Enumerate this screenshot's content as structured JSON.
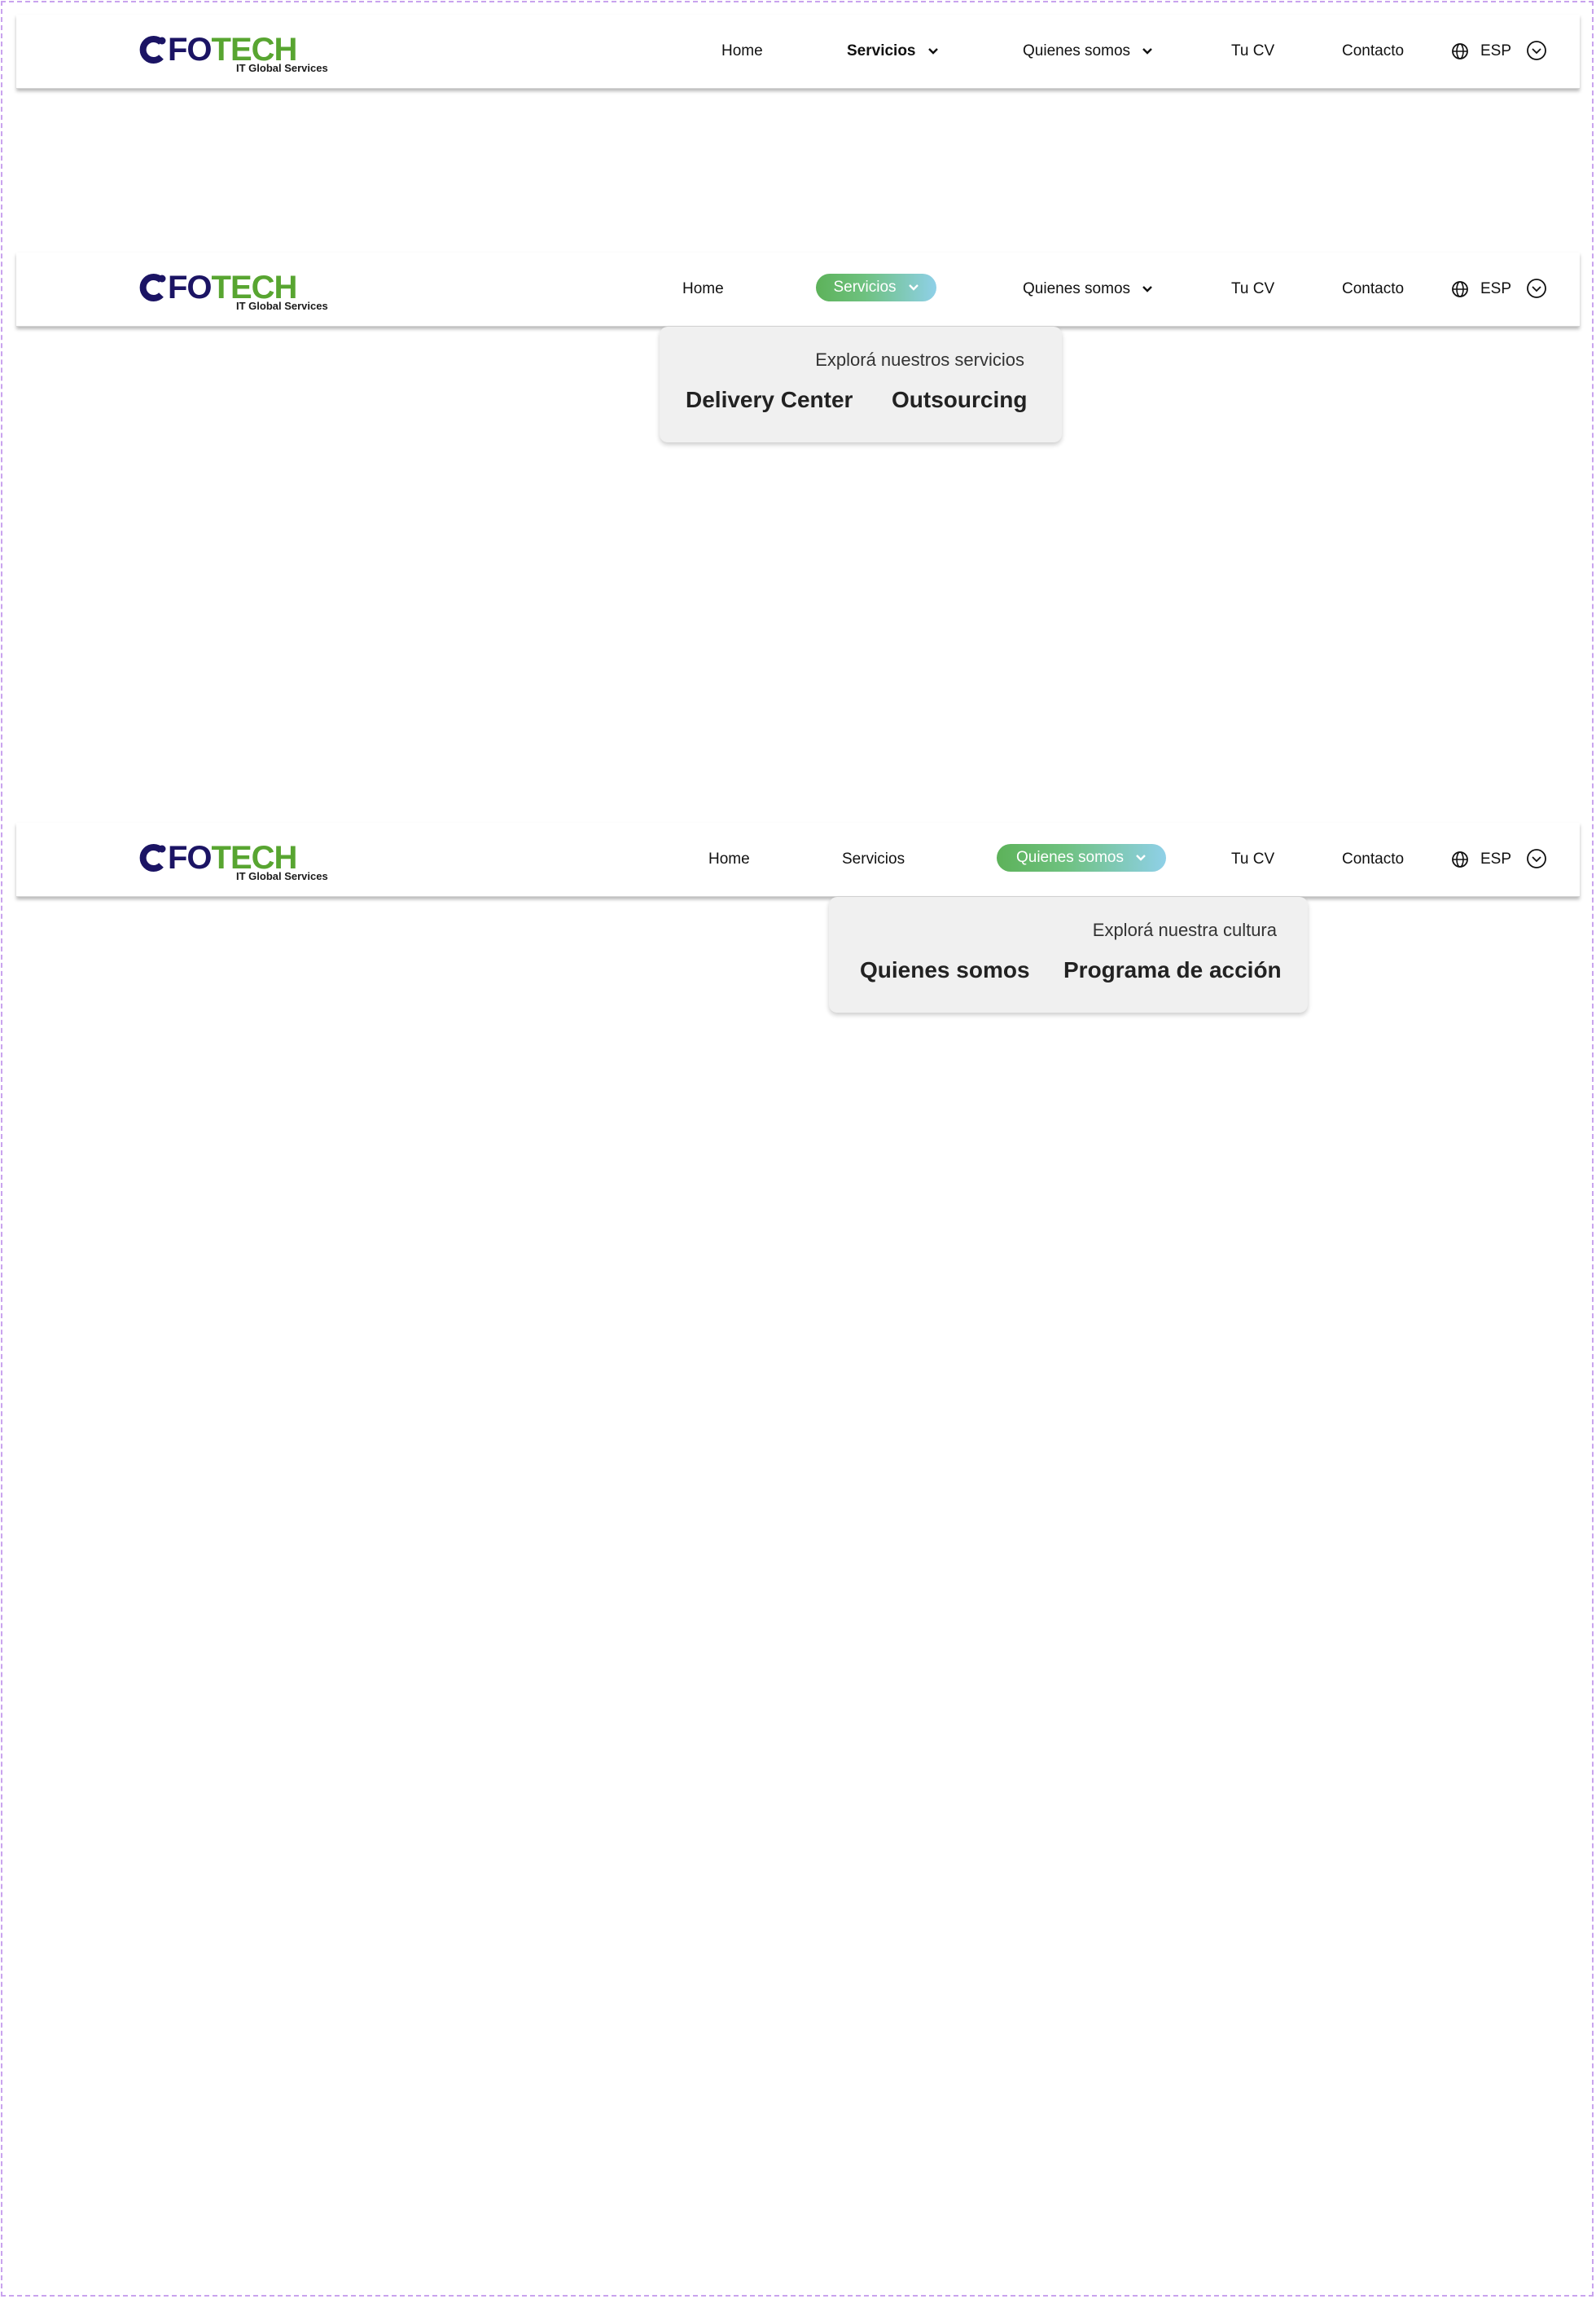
{
  "brand": {
    "name_part_navy": "FO",
    "name_part_green": "TECH",
    "tagline": "IT Global Services",
    "colors": {
      "navy": "#1b1464",
      "green": "#58a531"
    }
  },
  "nav": {
    "home": "Home",
    "servicios": "Servicios",
    "quienes": "Quienes somos",
    "cv": "Tu CV",
    "contacto": "Contacto",
    "lang": "ESP"
  },
  "servicios_menu": {
    "caption": "Explorá nuestros servicios",
    "links": [
      "Delivery Center",
      "Outsourcing"
    ]
  },
  "quienes_menu": {
    "caption": "Explorá nuestra cultura",
    "links": [
      "Quienes somos",
      "Programa de acción"
    ]
  },
  "states": [
    "default",
    "servicios-open",
    "quienes-somos-open"
  ],
  "active_pill_gradient": [
    "#5db25a",
    "#8fd0e8"
  ],
  "icons": [
    "globe-icon",
    "chevron-down-icon",
    "circle-chevron-down-icon"
  ]
}
